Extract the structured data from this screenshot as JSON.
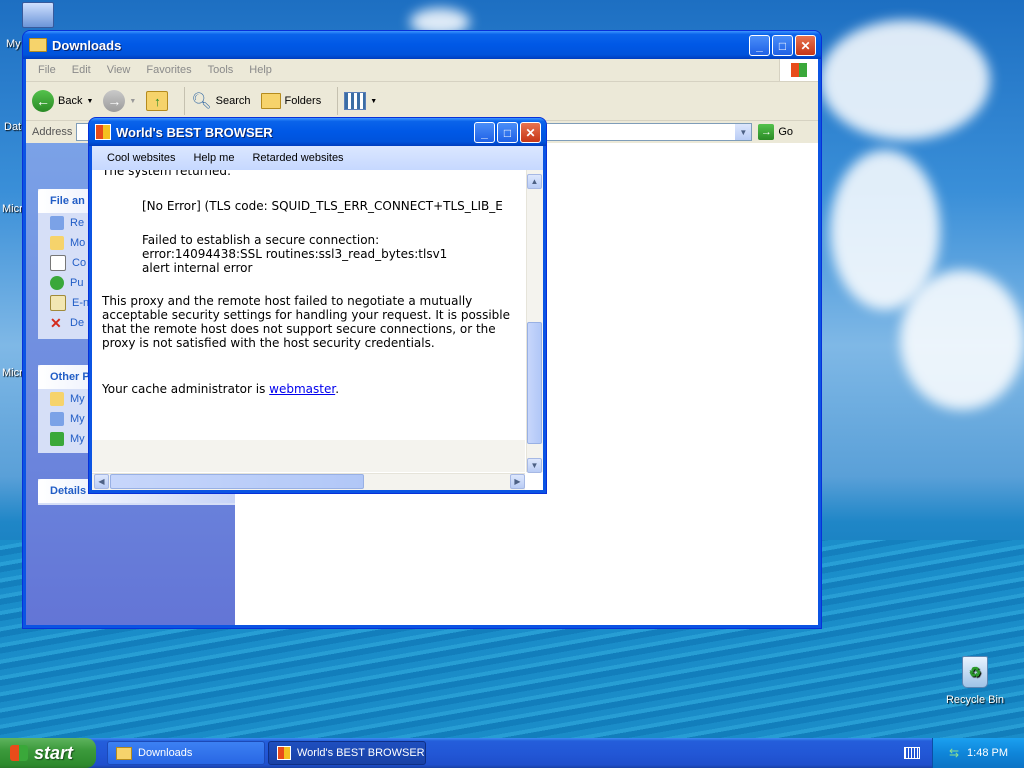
{
  "desktop": {
    "labels": [
      "My",
      "Dat",
      "Micr",
      "Micr"
    ],
    "recycle_bin": "Recycle Bin"
  },
  "explorer": {
    "title": "Downloads",
    "menu": [
      "File",
      "Edit",
      "View",
      "Favorites",
      "Tools",
      "Help"
    ],
    "toolbar": {
      "back": "Back",
      "search": "Search",
      "folders": "Folders"
    },
    "address_label": "Address",
    "go_label": "Go",
    "panels": {
      "file_tasks_head": "File an",
      "file_tasks_items": [
        "Re",
        "Mo",
        "Co",
        "Pu",
        "E-n",
        "De"
      ],
      "other_head": "Other P",
      "other_items": [
        "My",
        "My",
        "My"
      ],
      "details_head": "Details"
    }
  },
  "browser": {
    "title": "World's BEST BROWSER",
    "menu": [
      "Cool websites",
      "Help me",
      "Retarded websites"
    ],
    "content": {
      "returned": "The system returned:",
      "error_line": "[No Error] (TLS code: SQUID_TLS_ERR_CONNECT+TLS_LIB_E",
      "fail_1": "Failed to establish a secure connection:",
      "fail_2": "error:14094438:SSL routines:ssl3_read_bytes:tlsv1",
      "fail_3": "alert internal error",
      "para": "This proxy and the remote host failed to negotiate a mutually acceptable security settings for handling your request. It is possible that the remote host does not support secure connections, or the proxy is not satisfied with the host security credentials.",
      "admin_prefix": "Your cache administrator is ",
      "admin_link": "webmaster",
      "admin_suffix": "."
    }
  },
  "taskbar": {
    "start": "start",
    "tasks": [
      "Downloads",
      "World's BEST BROWSER"
    ],
    "clock": "1:48 PM"
  },
  "colors": {
    "xp_blue": "#0058e6",
    "start_green": "#3c9a3c",
    "link": "#0000ee"
  }
}
